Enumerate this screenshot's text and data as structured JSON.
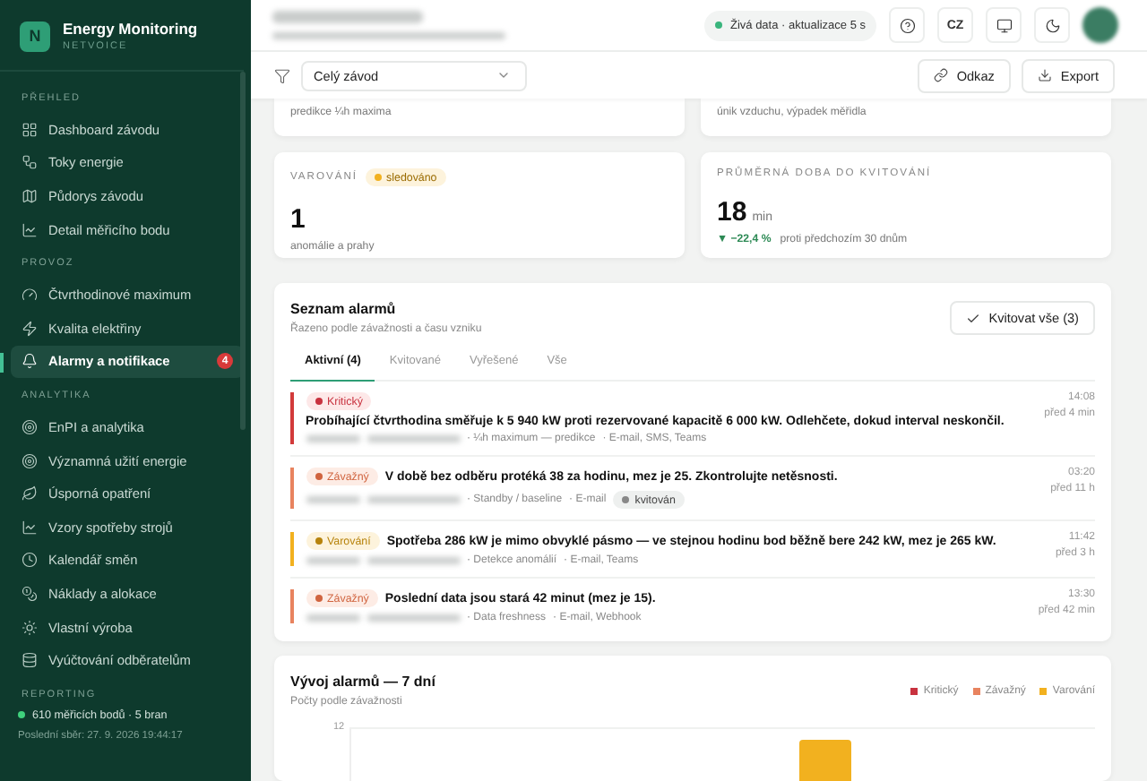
{
  "brand": {
    "logo_letter": "N",
    "title": "Energy Monitoring",
    "subtitle": "NETVOICE"
  },
  "sidebar": {
    "sections": [
      {
        "label": "PŘEHLED",
        "items": [
          {
            "label": "Dashboard závodu",
            "selected": false
          },
          {
            "label": "Toky energie",
            "selected": false
          },
          {
            "label": "Půdorys závodu",
            "selected": false
          },
          {
            "label": "Detail měřicího bodu",
            "selected": false
          }
        ]
      },
      {
        "label": "PROVOZ",
        "items": [
          {
            "label": "Čtvrthodinové maximum",
            "selected": false
          },
          {
            "label": "Kvalita elektřiny",
            "selected": false
          },
          {
            "label": "Alarmy a notifikace",
            "selected": true,
            "badge": "4"
          }
        ]
      },
      {
        "label": "ANALYTIKA",
        "items": [
          {
            "label": "EnPI a analytika",
            "selected": false
          },
          {
            "label": "Významná užití energie",
            "selected": false
          },
          {
            "label": "Úsporná opatření",
            "selected": false
          },
          {
            "label": "Vzory spotřeby strojů",
            "selected": false
          },
          {
            "label": "Kalendář směn",
            "selected": false
          },
          {
            "label": "Náklady a alokace",
            "selected": false
          },
          {
            "label": "Vlastní výroba",
            "selected": false
          },
          {
            "label": "Vyúčtování odběratelům",
            "selected": false
          }
        ]
      },
      {
        "label": "REPORTING"
      }
    ],
    "footer": {
      "status": "610 měřicích bodů · 5 bran",
      "last_sync": "Poslední sběr: 27. 9. 2026 19:44:17"
    }
  },
  "header": {
    "live_label": "Živá data · aktualizace 5 s",
    "language": "CZ"
  },
  "filter": {
    "select_value": "Celý závod",
    "buttons": [
      {
        "label": "Odkaz"
      },
      {
        "label": "Export"
      }
    ]
  },
  "top_cards": [
    {
      "caption": "predikce ¼h maxima"
    },
    {
      "caption": "únik vzduchu, výpadek měřidla"
    }
  ],
  "stat_cards": [
    {
      "title": "VAROVÁNÍ",
      "tag": "sledováno",
      "value": "1",
      "caption": "anomálie a prahy"
    },
    {
      "title": "PRŮMĚRNÁ DOBA DO KVITOVÁNÍ",
      "value": "18",
      "unit": "min",
      "delta": "▼ −22,4 %",
      "caption": "proti předchozím 30 dnům"
    }
  ],
  "alarms": {
    "title": "Seznam alarmů",
    "subtitle": "Řazeno podle závažnosti a času vzniku",
    "ack_all": "Kvitovat vše (3)",
    "tabs": [
      {
        "label": "Aktivní (4)",
        "selected": true
      },
      {
        "label": "Kvitované",
        "selected": false
      },
      {
        "label": "Vyřešené",
        "selected": false
      },
      {
        "label": "Vše",
        "selected": false
      }
    ],
    "rows": [
      {
        "kind": "critical",
        "severity": "Kritický",
        "message": "Probíhající čtvrthodina směřuje k 5 940 kW proti rezervované kapacitě 6 000 kW. Odlehčete, dokud interval neskončil.",
        "rule": "· ¼h maximum — predikce",
        "channels": "· E-mail, SMS, Teams",
        "acknowledged": false,
        "time": "14:08",
        "ago": "před 4 min"
      },
      {
        "kind": "serious",
        "severity": "Závažný",
        "message": "V době bez odběru protéká 38 za hodinu, mez je 25. Zkontrolujte netěsnosti.",
        "rule": "· Standby / baseline",
        "channels": "· E-mail",
        "acknowledged": true,
        "ack_label": "kvitován",
        "time": "03:20",
        "ago": "před 11 h"
      },
      {
        "kind": "warning",
        "severity": "Varování",
        "message": "Spotřeba 286 kW je mimo obvyklé pásmo — ve stejnou hodinu bod běžně bere 242 kW, mez je 265 kW.",
        "rule": "· Detekce anomálií",
        "channels": "· E-mail, Teams",
        "acknowledged": false,
        "time": "11:42",
        "ago": "před 3 h"
      },
      {
        "kind": "serious",
        "severity": "Závažný",
        "message": "Poslední data jsou stará 42 minut (mez je 15).",
        "rule": "· Data freshness",
        "channels": "· E-mail, Webhook",
        "acknowledged": false,
        "time": "13:30",
        "ago": "před 42 min"
      }
    ]
  },
  "trend": {
    "title": "Vývoj alarmů — 7 dní",
    "subtitle": "Počty podle závažnosti",
    "legend": [
      {
        "label": "Kritický",
        "color": "#c8323f"
      },
      {
        "label": "Závažný",
        "color": "#e8835f"
      },
      {
        "label": "Varování",
        "color": "#f2b11f"
      }
    ],
    "y_tick": "12"
  }
}
